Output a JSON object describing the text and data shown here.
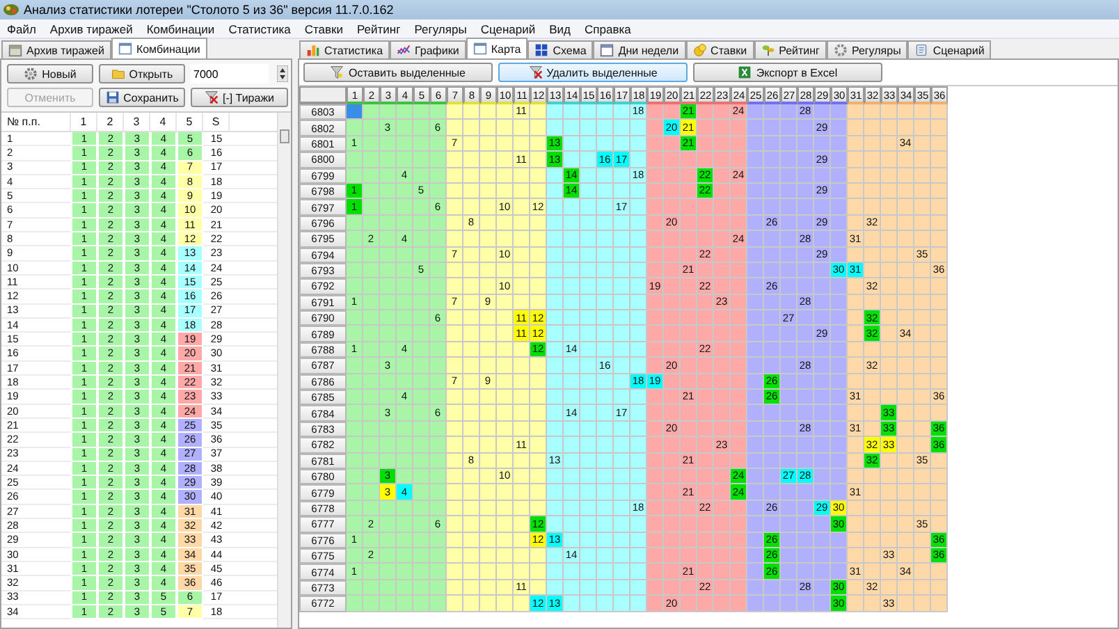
{
  "window": {
    "title": "Анализ статистики лотереи \"Столото 5 из 36\" версия 11.7.0.162"
  },
  "menu": [
    "Файл",
    "Архив тиражей",
    "Комбинации",
    "Статистика",
    "Ставки",
    "Рейтинг",
    "Регуляры",
    "Сценарий",
    "Вид",
    "Справка"
  ],
  "left_panel": {
    "tabs": [
      {
        "label": "Архив тиражей",
        "selected": false,
        "kind": "archive"
      },
      {
        "label": "Комбинации",
        "selected": true,
        "kind": "list"
      }
    ],
    "buttons": [
      {
        "label": "Новый",
        "kind": "gear",
        "disabled": false
      },
      {
        "label": "Открыть",
        "kind": "folder",
        "disabled": false
      },
      {
        "label": "Отменить",
        "kind": "none",
        "disabled": true
      },
      {
        "label": "Сохранить",
        "kind": "floppy",
        "disabled": false
      },
      {
        "label": "[-] Тиражи",
        "kind": "filter-x",
        "disabled": false
      }
    ],
    "count_field": {
      "value": "7000"
    },
    "table": {
      "columns": [
        "№ п.п.",
        "1",
        "2",
        "3",
        "4",
        "5",
        "S"
      ],
      "rows": [
        {
          "n": "1",
          "nums": [
            "1",
            "2",
            "3",
            "4",
            "5"
          ],
          "sum": "15"
        },
        {
          "n": "2",
          "nums": [
            "1",
            "2",
            "3",
            "4",
            "6"
          ],
          "sum": "16"
        },
        {
          "n": "3",
          "nums": [
            "1",
            "2",
            "3",
            "4",
            "7"
          ],
          "sum": "17"
        },
        {
          "n": "4",
          "nums": [
            "1",
            "2",
            "3",
            "4",
            "8"
          ],
          "sum": "18"
        },
        {
          "n": "5",
          "nums": [
            "1",
            "2",
            "3",
            "4",
            "9"
          ],
          "sum": "19"
        },
        {
          "n": "6",
          "nums": [
            "1",
            "2",
            "3",
            "4",
            "10"
          ],
          "sum": "20"
        },
        {
          "n": "7",
          "nums": [
            "1",
            "2",
            "3",
            "4",
            "11"
          ],
          "sum": "21"
        },
        {
          "n": "8",
          "nums": [
            "1",
            "2",
            "3",
            "4",
            "12"
          ],
          "sum": "22"
        },
        {
          "n": "9",
          "nums": [
            "1",
            "2",
            "3",
            "4",
            "13"
          ],
          "sum": "23"
        },
        {
          "n": "10",
          "nums": [
            "1",
            "2",
            "3",
            "4",
            "14"
          ],
          "sum": "24"
        },
        {
          "n": "11",
          "nums": [
            "1",
            "2",
            "3",
            "4",
            "15"
          ],
          "sum": "25"
        },
        {
          "n": "12",
          "nums": [
            "1",
            "2",
            "3",
            "4",
            "16"
          ],
          "sum": "26"
        },
        {
          "n": "13",
          "nums": [
            "1",
            "2",
            "3",
            "4",
            "17"
          ],
          "sum": "27"
        },
        {
          "n": "14",
          "nums": [
            "1",
            "2",
            "3",
            "4",
            "18"
          ],
          "sum": "28"
        },
        {
          "n": "15",
          "nums": [
            "1",
            "2",
            "3",
            "4",
            "19"
          ],
          "sum": "29"
        },
        {
          "n": "16",
          "nums": [
            "1",
            "2",
            "3",
            "4",
            "20"
          ],
          "sum": "30"
        },
        {
          "n": "17",
          "nums": [
            "1",
            "2",
            "3",
            "4",
            "21"
          ],
          "sum": "31"
        },
        {
          "n": "18",
          "nums": [
            "1",
            "2",
            "3",
            "4",
            "22"
          ],
          "sum": "32"
        },
        {
          "n": "19",
          "nums": [
            "1",
            "2",
            "3",
            "4",
            "23"
          ],
          "sum": "33"
        },
        {
          "n": "20",
          "nums": [
            "1",
            "2",
            "3",
            "4",
            "24"
          ],
          "sum": "34"
        },
        {
          "n": "21",
          "nums": [
            "1",
            "2",
            "3",
            "4",
            "25"
          ],
          "sum": "35"
        },
        {
          "n": "22",
          "nums": [
            "1",
            "2",
            "3",
            "4",
            "26"
          ],
          "sum": "36"
        },
        {
          "n": "23",
          "nums": [
            "1",
            "2",
            "3",
            "4",
            "27"
          ],
          "sum": "37"
        },
        {
          "n": "24",
          "nums": [
            "1",
            "2",
            "3",
            "4",
            "28"
          ],
          "sum": "38"
        },
        {
          "n": "25",
          "nums": [
            "1",
            "2",
            "3",
            "4",
            "29"
          ],
          "sum": "39"
        },
        {
          "n": "26",
          "nums": [
            "1",
            "2",
            "3",
            "4",
            "30"
          ],
          "sum": "40"
        },
        {
          "n": "27",
          "nums": [
            "1",
            "2",
            "3",
            "4",
            "31"
          ],
          "sum": "41"
        },
        {
          "n": "28",
          "nums": [
            "1",
            "2",
            "3",
            "4",
            "32"
          ],
          "sum": "42"
        },
        {
          "n": "29",
          "nums": [
            "1",
            "2",
            "3",
            "4",
            "33"
          ],
          "sum": "43"
        },
        {
          "n": "30",
          "nums": [
            "1",
            "2",
            "3",
            "4",
            "34"
          ],
          "sum": "44"
        },
        {
          "n": "31",
          "nums": [
            "1",
            "2",
            "3",
            "4",
            "35"
          ],
          "sum": "45"
        },
        {
          "n": "32",
          "nums": [
            "1",
            "2",
            "3",
            "4",
            "36"
          ],
          "sum": "46"
        },
        {
          "n": "33",
          "nums": [
            "1",
            "2",
            "3",
            "5",
            "6"
          ],
          "sum": "17"
        },
        {
          "n": "34",
          "nums": [
            "1",
            "2",
            "3",
            "5",
            "7"
          ],
          "sum": "18"
        }
      ]
    }
  },
  "right_panel": {
    "tabs": [
      {
        "label": "Статистика",
        "selected": false,
        "kind": "bars"
      },
      {
        "label": "Графики",
        "selected": false,
        "kind": "lines"
      },
      {
        "label": "Карта",
        "selected": true,
        "kind": "list"
      },
      {
        "label": "Схема",
        "selected": false,
        "kind": "grid"
      },
      {
        "label": "Дни недели",
        "selected": false,
        "kind": "calendar"
      },
      {
        "label": "Ставки",
        "selected": false,
        "kind": "coins"
      },
      {
        "label": "Рейтинг",
        "selected": false,
        "kind": "plant"
      },
      {
        "label": "Регуляры",
        "selected": false,
        "kind": "gear"
      },
      {
        "label": "Сценарий",
        "selected": false,
        "kind": "scroll"
      }
    ],
    "buttons": [
      {
        "label": "Оставить выделенные",
        "kind": "filter-star",
        "selected": false
      },
      {
        "label": "Удалить выделенные",
        "kind": "filter-x",
        "selected": true
      },
      {
        "label": "Экспорт в Excel",
        "kind": "excel",
        "selected": false
      }
    ],
    "grid": {
      "columns": [
        "1",
        "2",
        "3",
        "4",
        "5",
        "6",
        "7",
        "8",
        "9",
        "10",
        "11",
        "12",
        "13",
        "14",
        "15",
        "16",
        "17",
        "18",
        "19",
        "20",
        "21",
        "22",
        "23",
        "24",
        "25",
        "26",
        "27",
        "28",
        "29",
        "30",
        "31",
        "32",
        "33",
        "34",
        "35",
        "36"
      ],
      "rows": [
        {
          "draw": "6803",
          "cells": [
            {
              "color": "#3a8ee6"
            },
            "",
            "",
            "",
            "",
            "",
            "",
            "",
            "",
            "",
            "11",
            "",
            "",
            "",
            "",
            "",
            "",
            "18",
            "",
            "",
            {
              "text": "21",
              "color": "#00e000"
            },
            "",
            "",
            "24",
            "",
            "",
            "",
            "28",
            "",
            "",
            "",
            "",
            "",
            "",
            "",
            ""
          ]
        },
        {
          "draw": "6802",
          "cells": [
            "",
            "",
            "3",
            "",
            "",
            "6",
            "",
            "",
            "",
            "",
            "",
            "",
            "",
            "",
            "",
            "",
            "",
            "",
            "",
            {
              "text": "20",
              "color": "#00ffff"
            },
            {
              "text": "21",
              "color": "#ffff00"
            },
            "",
            "",
            "",
            "",
            "",
            "",
            "",
            "29",
            "",
            "",
            "",
            "",
            "",
            "",
            ""
          ]
        },
        {
          "draw": "6801",
          "cells": [
            "1",
            "",
            "",
            "",
            "",
            "",
            "7",
            "",
            "",
            "",
            "",
            "",
            {
              "text": "13",
              "color": "#00e000"
            },
            "",
            "",
            "",
            "",
            "",
            "",
            "",
            {
              "text": "21",
              "color": "#00e000"
            },
            "",
            "",
            "",
            "",
            "",
            "",
            "",
            "",
            "",
            "",
            "",
            "",
            "34",
            "",
            ""
          ]
        },
        {
          "draw": "6800",
          "cells": [
            "",
            "",
            "",
            "",
            "",
            "",
            "",
            "",
            "",
            "",
            "11",
            "",
            {
              "text": "13",
              "color": "#00e000"
            },
            "",
            "",
            {
              "text": "16",
              "color": "#00ffff"
            },
            {
              "text": "17",
              "color": "#00ffff"
            },
            "",
            "",
            "",
            "",
            "",
            "",
            "",
            "",
            "",
            "",
            "",
            "29",
            "",
            "",
            "",
            "",
            "",
            "",
            ""
          ]
        },
        {
          "draw": "6799",
          "cells": [
            "",
            "",
            "",
            "4",
            "",
            "",
            "",
            "",
            "",
            "",
            "",
            "",
            "",
            {
              "text": "14",
              "color": "#00e000"
            },
            "",
            "",
            "",
            "18",
            "",
            "",
            "",
            {
              "text": "22",
              "color": "#00e000"
            },
            "",
            "24",
            "",
            "",
            "",
            "",
            "",
            "",
            "",
            "",
            "",
            "",
            "",
            ""
          ]
        },
        {
          "draw": "6798",
          "cells": [
            {
              "text": "1",
              "color": "#00e000"
            },
            "",
            "",
            "",
            "5",
            "",
            "",
            "",
            "",
            "",
            "",
            "",
            "",
            {
              "text": "14",
              "color": "#00e000"
            },
            "",
            "",
            "",
            "",
            "",
            "",
            "",
            {
              "text": "22",
              "color": "#00e000"
            },
            "",
            "",
            "",
            "",
            "",
            "",
            "29",
            "",
            "",
            "",
            "",
            "",
            "",
            ""
          ]
        },
        {
          "draw": "6797",
          "cells": [
            {
              "text": "1",
              "color": "#00e000"
            },
            "",
            "",
            "",
            "",
            "6",
            "",
            "",
            "",
            "10",
            "",
            "12",
            "",
            "",
            "",
            "",
            "17",
            "",
            "",
            "",
            "",
            "",
            "",
            "",
            "",
            "",
            "",
            "",
            "",
            "",
            "",
            "",
            "",
            "",
            "",
            ""
          ]
        },
        {
          "draw": "6796",
          "cells": [
            "",
            "",
            "",
            "",
            "",
            "",
            "",
            "8",
            "",
            "",
            "",
            "",
            "",
            "",
            "",
            "",
            "",
            "",
            "",
            "20",
            "",
            "",
            "",
            "",
            "",
            "26",
            "",
            "",
            "29",
            "",
            "",
            "32",
            "",
            "",
            "",
            ""
          ]
        },
        {
          "draw": "6795",
          "cells": [
            "",
            "2",
            "",
            "4",
            "",
            "",
            "",
            "",
            "",
            "",
            "",
            "",
            "",
            "",
            "",
            "",
            "",
            "",
            "",
            "",
            "",
            "",
            "",
            "24",
            "",
            "",
            "",
            "28",
            "",
            "",
            "31",
            "",
            "",
            "",
            "",
            ""
          ]
        },
        {
          "draw": "6794",
          "cells": [
            "",
            "",
            "",
            "",
            "",
            "",
            "7",
            "",
            "",
            "10",
            "",
            "",
            "",
            "",
            "",
            "",
            "",
            "",
            "",
            "",
            "",
            "22",
            "",
            "",
            "",
            "",
            "",
            "",
            "29",
            "",
            "",
            "",
            "",
            "",
            "35",
            ""
          ]
        },
        {
          "draw": "6793",
          "cells": [
            "",
            "",
            "",
            "",
            "5",
            "",
            "",
            "",
            "",
            "",
            "",
            "",
            "",
            "",
            "",
            "",
            "",
            "",
            "",
            "",
            "21",
            "",
            "",
            "",
            "",
            "",
            "",
            "",
            "",
            {
              "text": "30",
              "color": "#00ffff"
            },
            {
              "text": "31",
              "color": "#00ffff"
            },
            "",
            "",
            "",
            "",
            "36"
          ]
        },
        {
          "draw": "6792",
          "cells": [
            "",
            "",
            "",
            "",
            "",
            "",
            "",
            "",
            "",
            "10",
            "",
            "",
            "",
            "",
            "",
            "",
            "",
            "",
            "19",
            "",
            "",
            "22",
            "",
            "",
            "",
            "26",
            "",
            "",
            "",
            "",
            "",
            "32",
            "",
            "",
            "",
            ""
          ]
        },
        {
          "draw": "6791",
          "cells": [
            "1",
            "",
            "",
            "",
            "",
            "",
            "7",
            "",
            "9",
            "",
            "",
            "",
            "",
            "",
            "",
            "",
            "",
            "",
            "",
            "",
            "",
            "",
            "23",
            "",
            "",
            "",
            "",
            "28",
            "",
            "",
            "",
            "",
            "",
            "",
            "",
            ""
          ]
        },
        {
          "draw": "6790",
          "cells": [
            "",
            "",
            "",
            "",
            "",
            "6",
            "",
            "",
            "",
            "",
            {
              "text": "11",
              "color": "#ffff00"
            },
            {
              "text": "12",
              "color": "#ffff00"
            },
            "",
            "",
            "",
            "",
            "",
            "",
            "",
            "",
            "",
            "",
            "",
            "",
            "",
            "",
            "27",
            "",
            "",
            "",
            "",
            {
              "text": "32",
              "color": "#00e000"
            },
            "",
            "",
            "",
            ""
          ]
        },
        {
          "draw": "6789",
          "cells": [
            "",
            "",
            "",
            "",
            "",
            "",
            "",
            "",
            "",
            "",
            {
              "text": "11",
              "color": "#ffff00"
            },
            {
              "text": "12",
              "color": "#ffff00"
            },
            "",
            "",
            "",
            "",
            "",
            "",
            "",
            "",
            "",
            "",
            "",
            "",
            "",
            "",
            "",
            "",
            "29",
            "",
            "",
            {
              "text": "32",
              "color": "#00e000"
            },
            "",
            "34",
            "",
            ""
          ]
        },
        {
          "draw": "6788",
          "cells": [
            "1",
            "",
            "",
            "4",
            "",
            "",
            "",
            "",
            "",
            "",
            "",
            {
              "text": "12",
              "color": "#00e000"
            },
            "",
            "14",
            "",
            "",
            "",
            "",
            "",
            "",
            "",
            "22",
            "",
            "",
            "",
            "",
            "",
            "",
            "",
            "",
            "",
            "",
            "",
            "",
            "",
            ""
          ]
        },
        {
          "draw": "6787",
          "cells": [
            "",
            "",
            "3",
            "",
            "",
            "",
            "",
            "",
            "",
            "",
            "",
            "",
            "",
            "",
            "",
            "16",
            "",
            "",
            "",
            "20",
            "",
            "",
            "",
            "",
            "",
            "",
            "",
            "28",
            "",
            "",
            "",
            "32",
            "",
            "",
            "",
            ""
          ]
        },
        {
          "draw": "6786",
          "cells": [
            "",
            "",
            "",
            "",
            "",
            "",
            "7",
            "",
            "9",
            "",
            "",
            "",
            "",
            "",
            "",
            "",
            "",
            {
              "text": "18",
              "color": "#00ffff"
            },
            {
              "text": "19",
              "color": "#00ffff"
            },
            "",
            "",
            "",
            "",
            "",
            "",
            {
              "text": "26",
              "color": "#00e000"
            },
            "",
            "",
            "",
            "",
            "",
            "",
            "",
            "",
            "",
            ""
          ]
        },
        {
          "draw": "6785",
          "cells": [
            "",
            "",
            "",
            "4",
            "",
            "",
            "",
            "",
            "",
            "",
            "",
            "",
            "",
            "",
            "",
            "",
            "",
            "",
            "",
            "",
            "21",
            "",
            "",
            "",
            "",
            {
              "text": "26",
              "color": "#00e000"
            },
            "",
            "",
            "",
            "",
            "31",
            "",
            "",
            "",
            "",
            "36"
          ]
        },
        {
          "draw": "6784",
          "cells": [
            "",
            "",
            "3",
            "",
            "",
            "6",
            "",
            "",
            "",
            "",
            "",
            "",
            "",
            "14",
            "",
            "",
            "17",
            "",
            "",
            "",
            "",
            "",
            "",
            "",
            "",
            "",
            "",
            "",
            "",
            "",
            "",
            "",
            {
              "text": "33",
              "color": "#00e000"
            },
            "",
            "",
            ""
          ]
        },
        {
          "draw": "6783",
          "cells": [
            "",
            "",
            "",
            "",
            "",
            "",
            "",
            "",
            "",
            "",
            "",
            "",
            "",
            "",
            "",
            "",
            "",
            "",
            "",
            "20",
            "",
            "",
            "",
            "",
            "",
            "",
            "",
            "28",
            "",
            "",
            "31",
            "",
            {
              "text": "33",
              "color": "#00e000"
            },
            "",
            "",
            {
              "text": "36",
              "color": "#00e000"
            }
          ]
        },
        {
          "draw": "6782",
          "cells": [
            "",
            "",
            "",
            "",
            "",
            "",
            "",
            "",
            "",
            "",
            "11",
            "",
            "",
            "",
            "",
            "",
            "",
            "",
            "",
            "",
            "",
            "",
            "23",
            "",
            "",
            "",
            "",
            "",
            "",
            "",
            "",
            {
              "text": "32",
              "color": "#ffff00"
            },
            {
              "text": "33",
              "color": "#ffff00"
            },
            "",
            "",
            {
              "text": "36",
              "color": "#00e000"
            }
          ]
        },
        {
          "draw": "6781",
          "cells": [
            "",
            "",
            "",
            "",
            "",
            "",
            "",
            "8",
            "",
            "",
            "",
            "",
            "13",
            "",
            "",
            "",
            "",
            "",
            "",
            "",
            "21",
            "",
            "",
            "",
            "",
            "",
            "",
            "",
            "",
            "",
            "",
            {
              "text": "32",
              "color": "#00e000"
            },
            "",
            "",
            "35",
            ""
          ]
        },
        {
          "draw": "6780",
          "cells": [
            "",
            "",
            {
              "text": "3",
              "color": "#00e000"
            },
            "",
            "",
            "",
            "",
            "",
            "",
            "10",
            "",
            "",
            "",
            "",
            "",
            "",
            "",
            "",
            "",
            "",
            "",
            "",
            "",
            {
              "text": "24",
              "color": "#00e000"
            },
            "",
            "",
            {
              "text": "27",
              "color": "#00ffff"
            },
            {
              "text": "28",
              "color": "#00ffff"
            },
            "",
            "",
            "",
            "",
            "",
            "",
            "",
            ""
          ]
        },
        {
          "draw": "6779",
          "cells": [
            "",
            "",
            {
              "text": "3",
              "color": "#ffff00"
            },
            {
              "text": "4",
              "color": "#00ffff"
            },
            "",
            "",
            "",
            "",
            "",
            "",
            "",
            "",
            "",
            "",
            "",
            "",
            "",
            "",
            "",
            "",
            "21",
            "",
            "",
            {
              "text": "24",
              "color": "#00e000"
            },
            "",
            "",
            "",
            "",
            "",
            "",
            "31",
            "",
            "",
            "",
            "",
            ""
          ]
        },
        {
          "draw": "6778",
          "cells": [
            "",
            "",
            "",
            "",
            "",
            "",
            "",
            "",
            "",
            "",
            "",
            "",
            "",
            "",
            "",
            "",
            "",
            "18",
            "",
            "",
            "",
            "22",
            "",
            "",
            "",
            "26",
            "",
            "",
            {
              "text": "29",
              "color": "#00ffff"
            },
            {
              "text": "30",
              "color": "#ffff00"
            },
            "",
            "",
            "",
            "",
            "",
            ""
          ]
        },
        {
          "draw": "6777",
          "cells": [
            "",
            "2",
            "",
            "",
            "",
            "6",
            "",
            "",
            "",
            "",
            "",
            {
              "text": "12",
              "color": "#00e000"
            },
            "",
            "",
            "",
            "",
            "",
            "",
            "",
            "",
            "",
            "",
            "",
            "",
            "",
            "",
            "",
            "",
            "",
            {
              "text": "30",
              "color": "#00e000"
            },
            "",
            "",
            "",
            "",
            "35",
            ""
          ]
        },
        {
          "draw": "6776",
          "cells": [
            "1",
            "",
            "",
            "",
            "",
            "",
            "",
            "",
            "",
            "",
            "",
            {
              "text": "12",
              "color": "#ffff00"
            },
            {
              "text": "13",
              "color": "#00ffff"
            },
            "",
            "",
            "",
            "",
            "",
            "",
            "",
            "",
            "",
            "",
            "",
            "",
            {
              "text": "26",
              "color": "#00e000"
            },
            "",
            "",
            "",
            "",
            "",
            "",
            "",
            "",
            "",
            {
              "text": "36",
              "color": "#00e000"
            }
          ]
        },
        {
          "draw": "6775",
          "cells": [
            "",
            "2",
            "",
            "",
            "",
            "",
            "",
            "",
            "",
            "",
            "",
            "",
            "",
            "14",
            "",
            "",
            "",
            "",
            "",
            "",
            "",
            "",
            "",
            "",
            "",
            {
              "text": "26",
              "color": "#00e000"
            },
            "",
            "",
            "",
            "",
            "",
            "",
            "33",
            "",
            "",
            {
              "text": "36",
              "color": "#00e000"
            }
          ]
        },
        {
          "draw": "6774",
          "cells": [
            "1",
            "",
            "",
            "",
            "",
            "",
            "",
            "",
            "",
            "",
            "",
            "",
            "",
            "",
            "",
            "",
            "",
            "",
            "",
            "",
            "21",
            "",
            "",
            "",
            "",
            {
              "text": "26",
              "color": "#00e000"
            },
            "",
            "",
            "",
            "",
            "31",
            "",
            "",
            "34",
            "",
            ""
          ]
        },
        {
          "draw": "6773",
          "cells": [
            "",
            "",
            "",
            "",
            "",
            "",
            "",
            "",
            "",
            "",
            "11",
            "",
            "",
            "",
            "",
            "",
            "",
            "",
            "",
            "",
            "",
            "22",
            "",
            "",
            "",
            "",
            "",
            "28",
            "",
            {
              "text": "30",
              "color": "#00e000"
            },
            "",
            "32",
            "",
            "",
            "",
            ""
          ]
        },
        {
          "draw": "6772",
          "cells": [
            "",
            "",
            "",
            "",
            "",
            "",
            "",
            "",
            "",
            "",
            "",
            {
              "text": "12",
              "color": "#00ffff"
            },
            {
              "text": "13",
              "color": "#00ffff"
            },
            "",
            "",
            "",
            "",
            "",
            "",
            "20",
            "",
            "",
            "",
            "",
            "",
            "",
            "",
            "",
            "",
            {
              "text": "30",
              "color": "#00e000"
            },
            "",
            "",
            "33",
            "",
            "",
            ""
          ]
        }
      ]
    }
  }
}
